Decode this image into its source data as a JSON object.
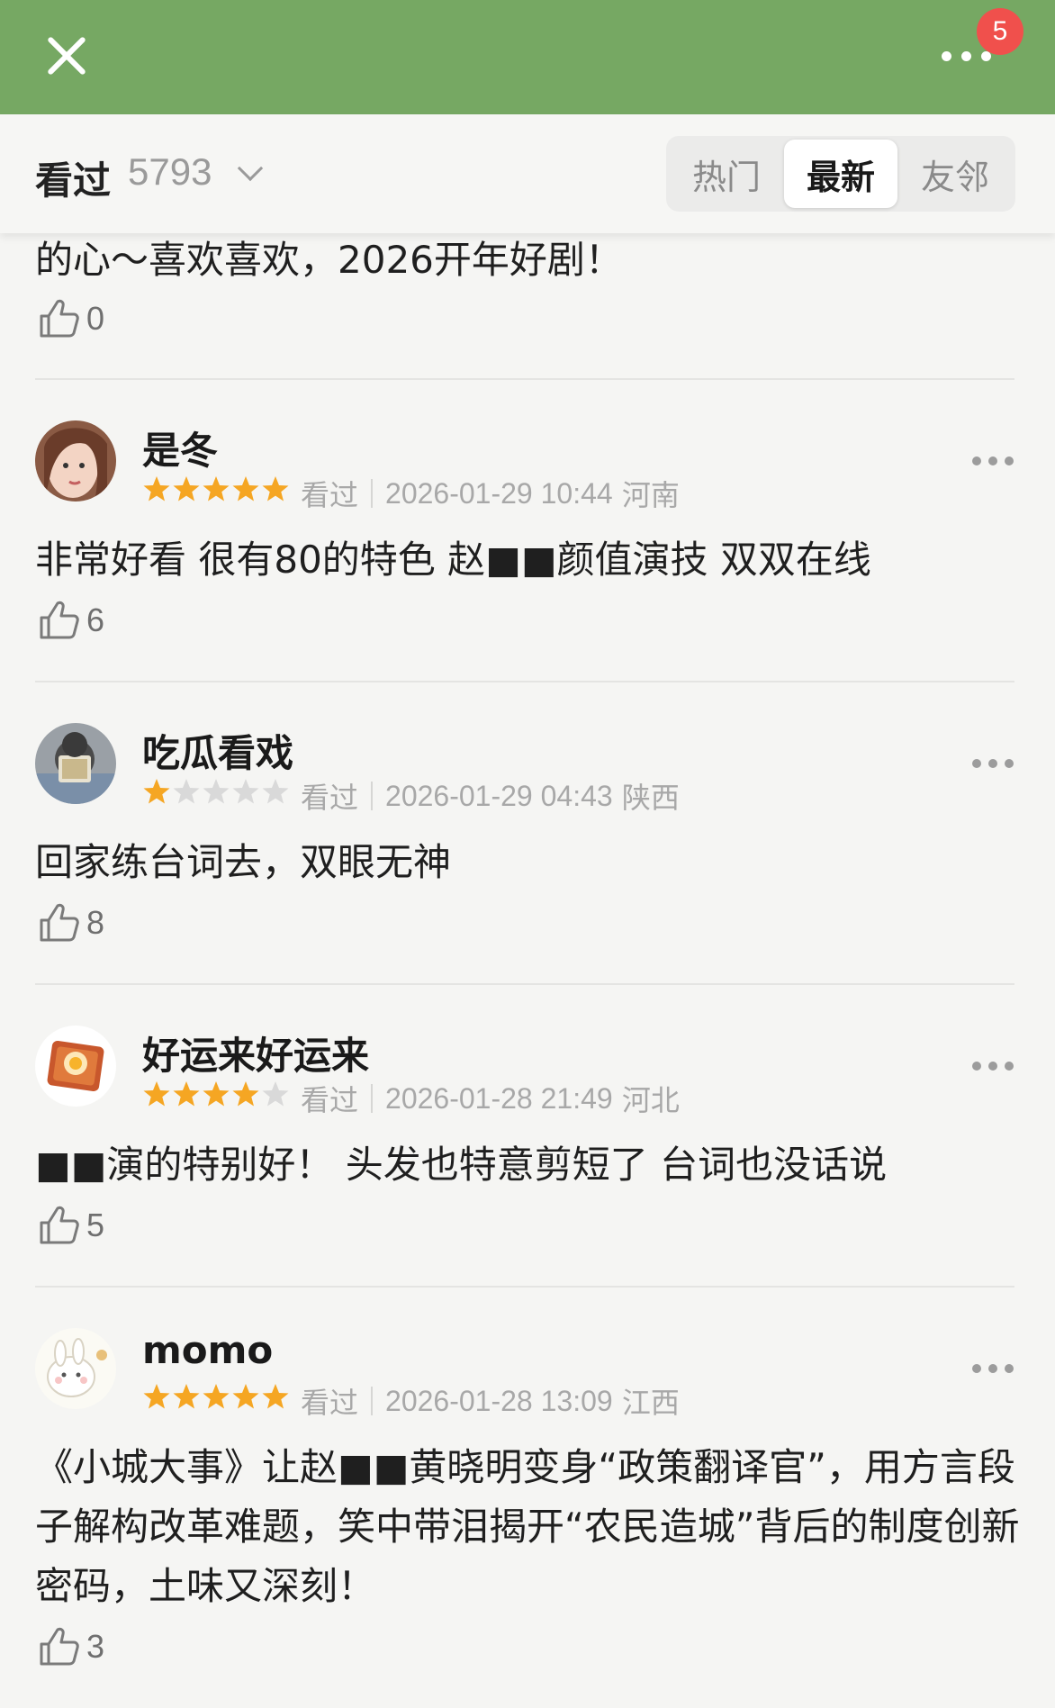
{
  "header": {
    "notification_count": "5"
  },
  "subheader": {
    "watched_label": "看过",
    "watched_count": "5793",
    "tabs": [
      {
        "label": "热门",
        "active": false
      },
      {
        "label": "最新",
        "active": true
      },
      {
        "label": "友邻",
        "active": false
      }
    ]
  },
  "partial_review": {
    "text": "的心～喜欢喜欢，2026开年好剧！",
    "likes": "0"
  },
  "reviews": [
    {
      "user": "是冬",
      "rating": 5,
      "status": "看过",
      "datetime": "2026-01-29 10:44",
      "location": "河南",
      "text": "非常好看 很有80的特色 赵■■颜值演技 双双在线",
      "likes": "6"
    },
    {
      "user": "吃瓜看戏",
      "rating": 1,
      "status": "看过",
      "datetime": "2026-01-29 04:43",
      "location": "陕西",
      "text": "回家练台词去，双眼无神",
      "likes": "8"
    },
    {
      "user": "好运来好运来",
      "rating": 4,
      "status": "看过",
      "datetime": "2026-01-28 21:49",
      "location": "河北",
      "text": "■■演的特别好！ 头发也特意剪短了 台词也没话说",
      "likes": "5"
    },
    {
      "user": "momo",
      "rating": 5,
      "status": "看过",
      "datetime": "2026-01-28 13:09",
      "location": "江西",
      "text": "《小城大事》让赵■■黄晓明变身“政策翻译官”，用方言段子解构改革难题，笑中带泪揭开“农民造城”背后的制度创新密码，土味又深刻！",
      "likes": "3"
    }
  ],
  "colors": {
    "header_bg": "#76a863",
    "star_filled": "#f5a623",
    "star_empty": "#d9d9d9",
    "badge": "#f0504c"
  }
}
